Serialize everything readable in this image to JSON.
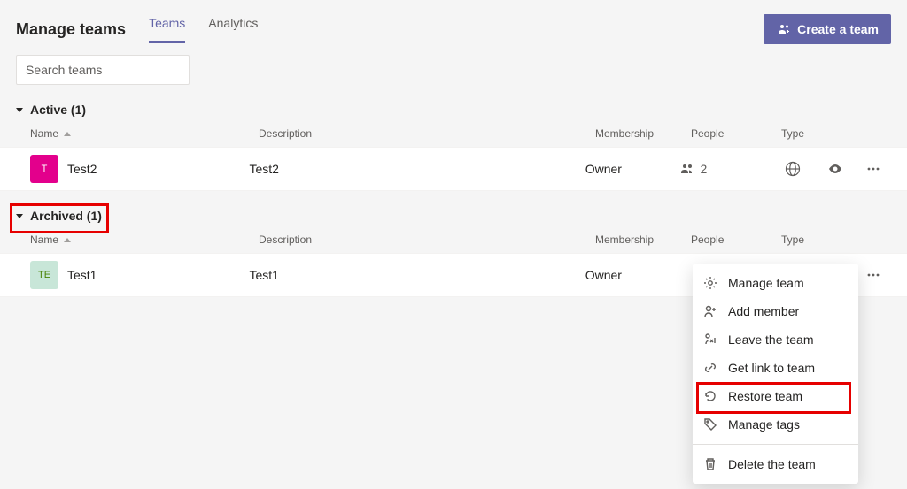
{
  "header": {
    "title": "Manage teams",
    "tabs": [
      {
        "label": "Teams",
        "active": true
      },
      {
        "label": "Analytics",
        "active": false
      }
    ],
    "create_button": "Create a team"
  },
  "search": {
    "placeholder": "Search teams"
  },
  "columns": {
    "name": "Name",
    "description": "Description",
    "membership": "Membership",
    "people": "People",
    "type": "Type"
  },
  "sections": {
    "active": {
      "label": "Active (1)"
    },
    "archived": {
      "label": "Archived (1)"
    }
  },
  "active_rows": [
    {
      "avatar_initial": "T",
      "name": "Test2",
      "description": "Test2",
      "membership": "Owner",
      "people_count": "2"
    }
  ],
  "archived_rows": [
    {
      "avatar_initial": "TE",
      "name": "Test1",
      "description": "Test1",
      "membership": "Owner"
    }
  ],
  "context_menu": {
    "manage_team": "Manage team",
    "add_member": "Add member",
    "leave_team": "Leave the team",
    "get_link": "Get link to team",
    "restore_team": "Restore team",
    "manage_tags": "Manage tags",
    "delete_team": "Delete the team"
  }
}
